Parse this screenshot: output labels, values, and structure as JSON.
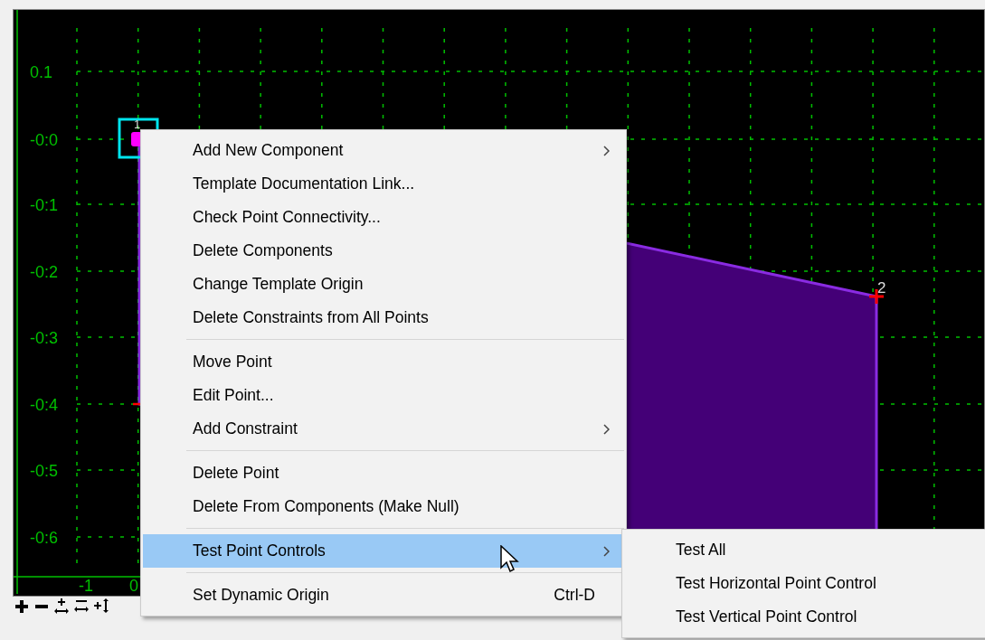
{
  "canvas": {
    "y_labels": [
      "0.1",
      "-0:0",
      "-0:1",
      "-0:2",
      "-0:3",
      "-0:4",
      "-0:5",
      "-0:6"
    ],
    "x_labels": [
      "-1",
      "0"
    ],
    "points": [
      {
        "label": "1",
        "selected": true
      },
      {
        "label": "2",
        "selected": false
      }
    ]
  },
  "menu": {
    "items": [
      {
        "kind": "submenu",
        "label": "Add New Component",
        "selected": false
      },
      {
        "kind": "item",
        "label": "Template Documentation Link...",
        "selected": false
      },
      {
        "kind": "item",
        "label": "Check Point Connectivity...",
        "selected": false
      },
      {
        "kind": "item",
        "label": "Delete Components",
        "selected": false
      },
      {
        "kind": "item",
        "label": "Change Template Origin",
        "selected": false
      },
      {
        "kind": "item",
        "label": "Delete Constraints from All Points",
        "selected": false
      },
      {
        "kind": "separator"
      },
      {
        "kind": "item",
        "label": "Move Point",
        "selected": false
      },
      {
        "kind": "item",
        "label": "Edit Point...",
        "selected": false
      },
      {
        "kind": "submenu",
        "label": "Add Constraint",
        "selected": false
      },
      {
        "kind": "separator"
      },
      {
        "kind": "item",
        "label": "Delete Point",
        "selected": false
      },
      {
        "kind": "item",
        "label": "Delete From Components (Make Null)",
        "selected": false
      },
      {
        "kind": "separator"
      },
      {
        "kind": "submenu",
        "label": "Test Point Controls",
        "selected": true
      },
      {
        "kind": "separator"
      },
      {
        "kind": "item",
        "label": "Set Dynamic Origin",
        "shortcut": "Ctrl-D",
        "selected": false
      }
    ]
  },
  "submenu": {
    "items": [
      {
        "label": "Test All",
        "selected": false
      },
      {
        "label": "Test Horizontal Point Control",
        "selected": false
      },
      {
        "label": "Test Vertical Point Control",
        "selected": false
      }
    ]
  }
}
